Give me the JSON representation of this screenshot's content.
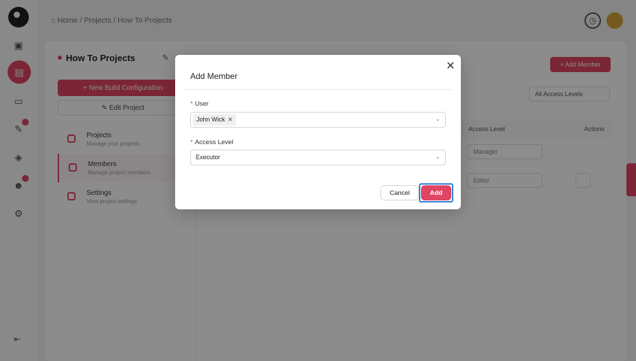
{
  "app": {
    "breadcrumb": "⌂ Home / Projects / How To Projects",
    "page_title": "How To Projects",
    "new_build_label": "+ New Build Configuration",
    "edit_project_label": "✎ Edit Project",
    "add_member_label": "+ Add Member",
    "filter_label": "All Access Levels",
    "table_headers": {
      "access": "Access Level",
      "actions": "Actions"
    },
    "rows": [
      {
        "access": "Manager"
      },
      {
        "access": "Editor"
      }
    ],
    "nav": [
      {
        "title": "Projects",
        "subtitle": "Manage your projects"
      },
      {
        "title": "Members",
        "subtitle": "Manage project members"
      },
      {
        "title": "Settings",
        "subtitle": "View project settings"
      }
    ]
  },
  "modal": {
    "title": "Add Member",
    "user_label": "User",
    "user_tag": "John Wick",
    "access_label": "Access Level",
    "access_value": "Executor",
    "cancel_label": "Cancel",
    "add_label": "Add",
    "close_glyph": "✕"
  },
  "colors": {
    "accent": "#e04563",
    "focus": "#2f7fd6"
  }
}
